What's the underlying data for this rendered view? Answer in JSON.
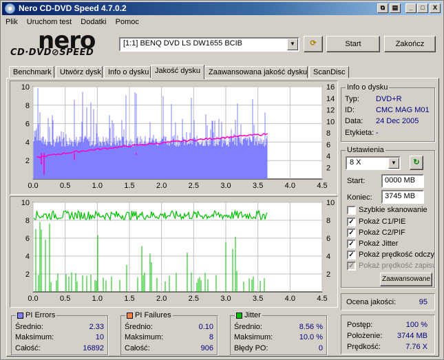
{
  "window": {
    "title": "Nero CD-DVD Speed 4.7.0.2",
    "buttons": [
      "_",
      "□",
      "X"
    ]
  },
  "menu": [
    "Plik",
    "Uruchom test",
    "Dodatki",
    "Pomoc"
  ],
  "logo": {
    "brand": "nero",
    "sub": "CD·DVD⊘SPEED"
  },
  "toolbar": {
    "drive": "[1:1]  BENQ DVD LS DW1655 BCIB",
    "start_label": "Start",
    "end_label": "Zakończ"
  },
  "tabs": [
    {
      "label": "Benchmark"
    },
    {
      "label": "Utwórz dysk"
    },
    {
      "label": "Info o dysku"
    },
    {
      "label": "Jakość dysku"
    },
    {
      "label": "Zaawansowana jakość dysku"
    },
    {
      "label": "ScanDisc"
    }
  ],
  "disc_info": {
    "title": "Info o dysku",
    "type_label": "Typ:",
    "type_value": "DVD+R",
    "id_label": "ID:",
    "id_value": "CMC MAG M01",
    "date_label": "Data:",
    "date_value": "24 Dec 2005",
    "tag_label": "Etykieta:",
    "tag_value": "-"
  },
  "settings": {
    "title": "Ustawienia",
    "speed": "8 X",
    "start_label": "Start:",
    "start_value": "0000 MB",
    "end_label": "Koniec:",
    "end_value": "3745 MB",
    "checkboxes": [
      {
        "label": "Szybkie skanowanie",
        "checked": false
      },
      {
        "label": "Pokaż C1/PIE",
        "checked": true
      },
      {
        "label": "Pokaż C2/PIF",
        "checked": true
      },
      {
        "label": "Pokaż Jitter",
        "checked": true
      },
      {
        "label": "Pokaż prędkość odczytu",
        "checked": true
      },
      {
        "label": "Pokaż prędkość zapisu",
        "checked": true,
        "disabled": true
      }
    ],
    "advanced_label": "Zaawansowane"
  },
  "quality": {
    "label": "Ocena jakości:",
    "value": "95"
  },
  "progress": {
    "progress_label": "Postęp:",
    "progress_value": "100 %",
    "position_label": "Położenie:",
    "position_value": "3744 MB",
    "speed_label": "Prędkość:",
    "speed_value": "7.76 X"
  },
  "pi_errors": {
    "title": "PI Errors",
    "color": "#8080ff",
    "avg_label": "Średnio:",
    "avg": "2.33",
    "max_label": "Maksimum:",
    "max": "10",
    "total_label": "Całość:",
    "total": "16892"
  },
  "pi_failures": {
    "title": "PI Failures",
    "color": "#ff8040",
    "avg_label": "Średnio:",
    "avg": "0.10",
    "max_label": "Maksimum:",
    "max": "8",
    "total_label": "Całość:",
    "total": "906"
  },
  "jitter": {
    "title": "Jitter",
    "color": "#00c000",
    "avg_label": "Średnio:",
    "avg": "8.56 %",
    "max_label": "Maksimum:",
    "max": "10.0 %",
    "po_label": "Błędy PO:",
    "po": "0"
  },
  "chart_data": [
    {
      "type": "bar",
      "name": "PI Errors",
      "x_ticks": [
        "0.0",
        "0.5",
        "1.0",
        "1.5",
        "2.0",
        "2.5",
        "3.0",
        "3.5",
        "4.0",
        "4.5"
      ],
      "y_left_ticks": [
        "2",
        "4",
        "6",
        "8",
        "10"
      ],
      "y_right_ticks": [
        "2",
        "4",
        "6",
        "8",
        "10",
        "12",
        "14",
        "16"
      ],
      "xlim": [
        0,
        4.5
      ],
      "ylim": [
        0,
        10
      ],
      "y2lim": [
        0,
        16
      ],
      "data_end_gb": 3.65,
      "pie_baseline": 3.5,
      "pie_max": 10,
      "read_speed_start_x": 3.6,
      "read_speed_end_x": 7.8,
      "colors": {
        "bars": "#8080ff",
        "speed": "#ff00c0",
        "bg": "#ffffff"
      }
    },
    {
      "type": "bar",
      "name": "PI Failures / Jitter",
      "x_ticks": [
        "0.0",
        "0.5",
        "1.0",
        "1.5",
        "2.0",
        "2.5",
        "3.0",
        "3.5",
        "4.0",
        "4.5"
      ],
      "y_left_ticks": [
        "2",
        "4",
        "6",
        "8",
        "10"
      ],
      "y_right_ticks": [
        "2",
        "4",
        "6",
        "8",
        "10"
      ],
      "xlim": [
        0,
        4.5
      ],
      "ylim": [
        0,
        10
      ],
      "data_end_gb": 3.65,
      "jitter_avg": 8.56,
      "jitter_max": 10.0,
      "pif_max": 8,
      "colors": {
        "bars": "#00c000",
        "jitter": "#00c000",
        "bg": "#ffffff"
      }
    }
  ]
}
